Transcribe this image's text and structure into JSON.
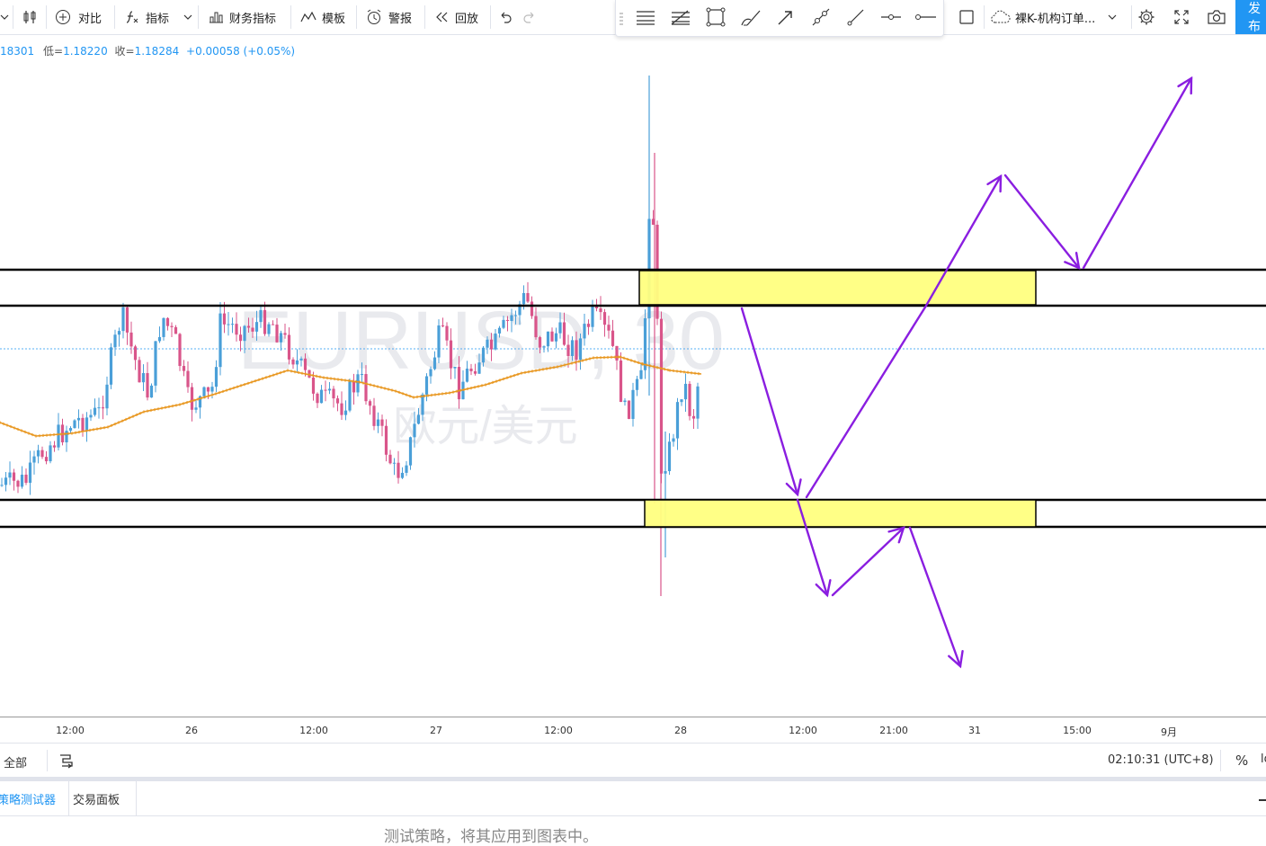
{
  "toolbar": {
    "compare_label": "对比",
    "indicators_label": "指标",
    "financials_label": "财务指标",
    "templates_label": "模板",
    "alerts_label": "警报",
    "replay_label": "回放",
    "template_name": "裸K-机构订单...",
    "publish_label": "发布"
  },
  "ohlc": {
    "open_partial": "18301",
    "low_label": "低=",
    "low_value": "1.18220",
    "close_label": "收=",
    "close_value": "1.18284",
    "change": "+0.00058 (+0.05%)"
  },
  "watermark": {
    "symbol": "EURUSD, 30",
    "name": "欧元/美元"
  },
  "time_axis": {
    "labels": [
      "12:00",
      "26",
      "12:00",
      "27",
      "12:00",
      "28",
      "12:00",
      "21:00",
      "31",
      "15:00",
      "9月"
    ]
  },
  "bottom_bar": {
    "range_all": "全部",
    "clock": "02:10:31 (UTC+8)",
    "percent": "%",
    "log_partial": "lo"
  },
  "panel": {
    "tabs": [
      "策略测试器",
      "交易面板"
    ],
    "message": "测试策略，将其应用到图表中。"
  },
  "colors": {
    "up_candle": "#4a9fd8",
    "down_candle": "#d9558a",
    "moving_average": "#e8961e",
    "zone_fill": "#ffff80",
    "arrow": "#8a1ee0",
    "accent": "#2196f3"
  }
}
